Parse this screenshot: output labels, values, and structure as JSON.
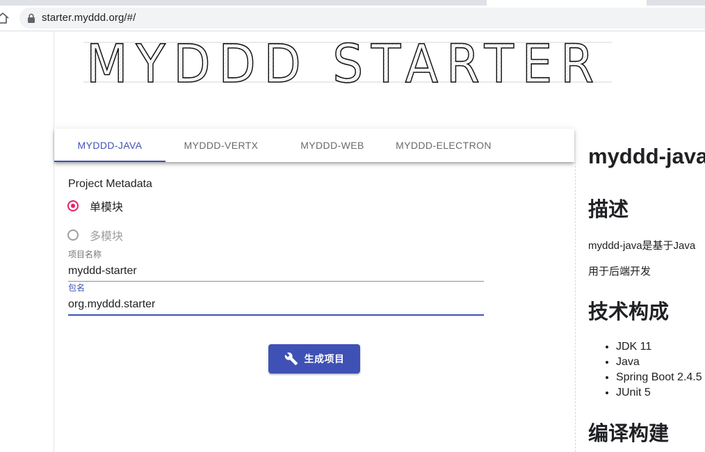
{
  "browser": {
    "url": "starter.myddd.org/#/",
    "icons": {
      "home": "home-icon",
      "lock": "lock-icon"
    }
  },
  "logo": {
    "text": "MYDDD STARTER"
  },
  "tabs": [
    {
      "label": "MYDDD-JAVA",
      "active": true
    },
    {
      "label": "MYDDD-VERTX",
      "active": false
    },
    {
      "label": "MYDDD-WEB",
      "active": false
    },
    {
      "label": "MYDDD-ELECTRON",
      "active": false
    }
  ],
  "form": {
    "section_title": "Project Metadata",
    "radios": [
      {
        "label": "单模块",
        "selected": true
      },
      {
        "label": "多模块",
        "selected": false
      }
    ],
    "fields": [
      {
        "label": "项目名称",
        "value": "myddd-starter",
        "focused": false
      },
      {
        "label": "包名",
        "value": "org.myddd.starter",
        "focused": true
      }
    ],
    "generate_button": {
      "label": "生成项目",
      "icon": "wrench-icon"
    }
  },
  "doc": {
    "title": "myddd-java",
    "sections": [
      {
        "heading": "描述",
        "paragraphs": [
          "myddd-java是基于Java",
          "用于后端开发"
        ]
      },
      {
        "heading": "技术构成",
        "items": [
          "JDK 11",
          "Java",
          "Spring Boot 2.4.5",
          "JUnit 5"
        ]
      },
      {
        "heading": "编译构建"
      }
    ]
  },
  "colors": {
    "primary": "#3f51b5",
    "radio_accent": "#e91e63",
    "text": "#202124",
    "muted": "#9e9e9e"
  }
}
